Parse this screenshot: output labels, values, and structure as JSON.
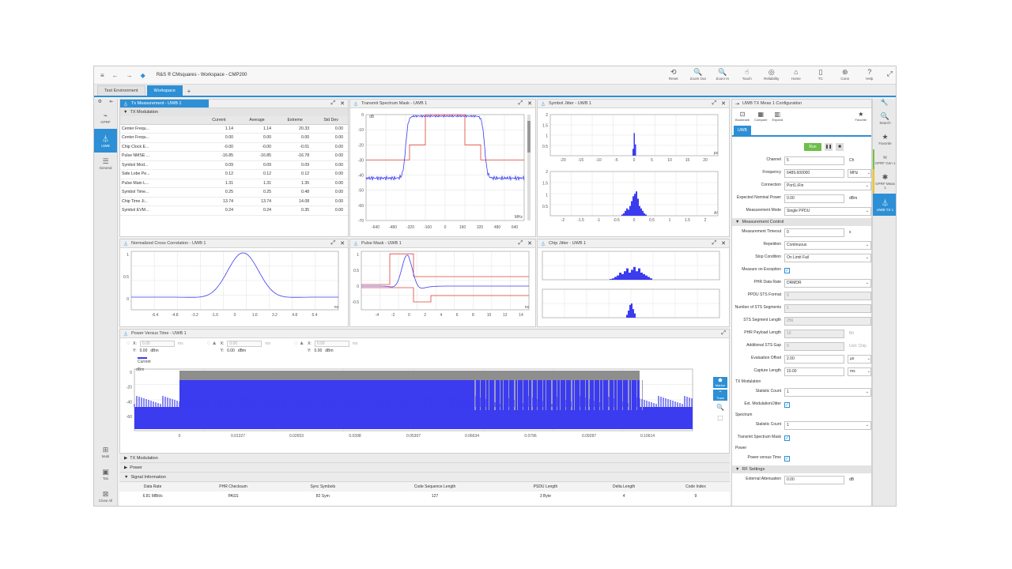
{
  "app": {
    "title": "R&S ® CMsquares - Workspace - CMP200",
    "toolbar": [
      {
        "icon": "reset-icon",
        "glyph": "⟲",
        "label": "Reset"
      },
      {
        "icon": "zoom-out-icon",
        "glyph": "🔍",
        "label": "Zoom Out"
      },
      {
        "icon": "zoom-in-icon",
        "glyph": "🔍",
        "label": "Zoom In"
      },
      {
        "icon": "touch-icon",
        "glyph": "☝",
        "label": "Touch"
      },
      {
        "icon": "reliability-icon",
        "glyph": "◎",
        "label": "Reliability"
      },
      {
        "icon": "home-icon",
        "glyph": "⌂",
        "label": "Home"
      },
      {
        "icon": "tc-icon",
        "glyph": "▯",
        "label": "TC"
      },
      {
        "icon": "conn-icon",
        "glyph": "⊛",
        "label": "Conn"
      },
      {
        "icon": "help-icon",
        "glyph": "?",
        "label": "Help"
      }
    ],
    "tabs": [
      {
        "label": "Test Environment",
        "active": false
      },
      {
        "label": "Workspace",
        "active": true
      }
    ]
  },
  "left_sidebar": [
    {
      "icon": "gprf-icon",
      "glyph": "⌁",
      "label": "GPRF",
      "active": false
    },
    {
      "icon": "uwb-icon",
      "glyph": "⏃",
      "label": "UWB",
      "active": true
    },
    {
      "icon": "general-icon",
      "glyph": "☰",
      "label": "General",
      "active": false
    }
  ],
  "left_sidebar_bottom": [
    {
      "icon": "multi-icon",
      "glyph": "⊞",
      "label": "Multi"
    },
    {
      "icon": "tas-icon",
      "glyph": "▣",
      "label": "Tas"
    },
    {
      "icon": "close-all-icon",
      "glyph": "⊠",
      "label": "Close All"
    }
  ],
  "right_sidebar": [
    {
      "icon": "search-icon",
      "glyph": "🔍",
      "label": "Search",
      "variant": ""
    },
    {
      "icon": "favorite-icon",
      "glyph": "★",
      "label": "Favorite",
      "variant": ""
    },
    {
      "icon": "gprf-gen-icon",
      "glyph": "≈",
      "label": "GPRF Gen 1",
      "variant": "green"
    },
    {
      "icon": "gprf-meas-icon",
      "glyph": "✱",
      "label": "GPRF Meas 1",
      "variant": "yellow"
    },
    {
      "icon": "uwb-tx-icon",
      "glyph": "⏃",
      "label": "UWB TX 1",
      "variant": "active"
    }
  ],
  "tx_panel": {
    "title": "Tx Measurement - UWB 1",
    "section": "TX Modulation",
    "columns": [
      "",
      "Current",
      "Average",
      "Extreme",
      "Std Dev"
    ],
    "rows": [
      [
        "Center Frequ...",
        "1.14",
        "1.14",
        "20.33",
        "0.00"
      ],
      [
        "Center Frequ...",
        "0.00",
        "0.00",
        "0.00",
        "0.00"
      ],
      [
        "Chip Clock E...",
        "-0.00",
        "-0.00",
        "-0.01",
        "0.00"
      ],
      [
        "Pulse NMSE ...",
        "-16.85",
        "-16.85",
        "-16.78",
        "0.00"
      ],
      [
        "Symbol Mod...",
        "0.09",
        "0.09",
        "0.09",
        "0.00"
      ],
      [
        "Side Lobe Pe...",
        "0.12",
        "0.12",
        "0.12",
        "0.00"
      ],
      [
        "Pulse Main L...",
        "1.31",
        "1.31",
        "1.35",
        "0.00"
      ],
      [
        "Symbol Time...",
        "0.25",
        "0.25",
        "0.48",
        "0.00"
      ],
      [
        "Chip Time Ji...",
        "13.74",
        "13.74",
        "14.08",
        "0.00"
      ],
      [
        "Symbol EVM...",
        "0.24",
        "0.24",
        "0.35",
        "0.00"
      ]
    ]
  },
  "spectrum_panel": {
    "title": "Transmit Spectrum Mask - UWB 1",
    "yunit": "dB",
    "xunit": "MHz",
    "yticks": [
      "0",
      "-10",
      "-20",
      "-30",
      "-40",
      "-50",
      "-60",
      "-70"
    ],
    "xticks": [
      "-640",
      "-480",
      "-320",
      "-160",
      "0",
      "160",
      "320",
      "480",
      "640"
    ]
  },
  "symbol_jitter_panel": {
    "title": "Symbol Jitter - UWB 1",
    "xunit": "ps",
    "xunit2": "A²",
    "top_yticks": [
      "2",
      "1.5",
      "1",
      "0.5"
    ],
    "top_xticks": [
      "-20",
      "-15",
      "-10",
      "-5",
      "0",
      "5",
      "10",
      "15",
      "20"
    ],
    "bot_yticks": [
      "2",
      "1.5",
      "1",
      "0.5"
    ],
    "bot_xticks": [
      "-2",
      "-1.5",
      "-1",
      "-0.5",
      "0",
      "0.5",
      "1",
      "1.5",
      "2"
    ]
  },
  "cross_corr_panel": {
    "title": "Normalized Cross Correlation - UWB 1",
    "xunit": "ns",
    "yticks": [
      "1",
      "0.5",
      "0"
    ],
    "xticks": [
      "-6.4",
      "-4.8",
      "-3.2",
      "-1.6",
      "0",
      "1.6",
      "3.2",
      "4.8",
      "6.4"
    ]
  },
  "pulse_mask_panel": {
    "title": "Pulse Mask - UWB 1",
    "xunit": "ns",
    "yticks": [
      "1",
      "0.5",
      "0",
      "-0.5"
    ],
    "xticks": [
      "-4",
      "-2",
      "0",
      "2",
      "4",
      "6",
      "8",
      "10",
      "12",
      "14"
    ]
  },
  "chip_jitter_panel": {
    "title": "Chip Jitter - UWB 1"
  },
  "pvt_panel": {
    "title": "Power Versus Time - UWB 1",
    "markers": [
      {
        "x_label": "X:",
        "x_value": "0.00",
        "x_unit": "ms",
        "y_label": "Y:",
        "y_value": "0.00",
        "y_unit": "dBm"
      },
      {
        "x_label": "X:",
        "x_value": "0.00",
        "x_unit": "ms",
        "y_label": "Y:",
        "y_value": "0.00",
        "y_unit": "dBm"
      },
      {
        "x_label": "X:",
        "x_value": "0.00",
        "x_unit": "ms",
        "y_label": "Y:",
        "y_value": "0.00",
        "y_unit": "dBm"
      }
    ],
    "legend": "Current",
    "yunit": "dBm",
    "yticks": [
      "0",
      "-20",
      "-40",
      "-60"
    ],
    "xticks": [
      "0",
      "0.01327",
      "0.02653",
      "0.0398",
      "0.05307",
      "0.06634",
      "0.0796",
      "0.09287",
      "0.10614"
    ],
    "side_buttons": [
      {
        "icon": "marker-icon",
        "glyph": "⬟",
        "label": "Marker"
      },
      {
        "icon": "trace-icon",
        "glyph": "⌃",
        "label": "Trace"
      }
    ]
  },
  "bottom_sections": [
    "TX Modulation",
    "Power",
    "Signal Information"
  ],
  "signal_info": {
    "columns": [
      "Data Rate",
      "PHR Checksum",
      "Sync Symbols",
      "Code Sequence Length",
      "PSDU Length",
      "Delta Length",
      "Code Index"
    ],
    "values": [
      "6.81 MBit/s",
      "PASS",
      "82 Sym",
      "127",
      "3 Byte",
      "4",
      "9"
    ]
  },
  "config_panel": {
    "title": "UWB TX Meas 1 Configuration",
    "tools": [
      {
        "icon": "bookmark-icon",
        "glyph": "⊡",
        "label": "Bookmark"
      },
      {
        "icon": "compare-icon",
        "glyph": "▦",
        "label": "Compare"
      },
      {
        "icon": "expand-icon",
        "glyph": "▥",
        "label": "Expand"
      },
      {
        "icon": "favorite-icon",
        "glyph": "★",
        "label": "Favorite"
      }
    ],
    "tab": "UWB",
    "run_label": "Run",
    "main_rows": [
      {
        "label": "Channel",
        "value": "5",
        "unit": "Ch",
        "dis": false,
        "box": false
      },
      {
        "label": "Frequency",
        "value": "6489.600000",
        "unit": "MHz",
        "dis": false,
        "box": true
      },
      {
        "label": "Connection",
        "value": "Port1.iFin",
        "unit": "",
        "dis": false,
        "box": false,
        "wide": true
      },
      {
        "label": "Expected Nominal Power",
        "value": "0.00",
        "unit": "dBm",
        "dis": false,
        "box": false
      },
      {
        "label": "Measurement Mode",
        "value": "Single PPDU",
        "unit": "",
        "dis": false,
        "box": false,
        "wide": true
      }
    ],
    "control_section": "Measurement Control",
    "control_rows": [
      {
        "label": "Measurement Timeout",
        "value": "0",
        "unit": "s",
        "dis": false,
        "box": false
      },
      {
        "label": "Repetition",
        "value": "Continuous",
        "unit": "",
        "dis": false,
        "box": false,
        "wide": true
      },
      {
        "label": "Stop Condition",
        "value": "On Limit Fail",
        "unit": "",
        "dis": false,
        "box": false,
        "wide": true
      },
      {
        "label": "Measure on Exception",
        "check": true
      },
      {
        "label": "PHR Data Rate",
        "value": "DRMDR",
        "unit": "",
        "dis": false,
        "box": false,
        "wide": true
      },
      {
        "label": "PPDU STS Format",
        "value": "0",
        "unit": "",
        "dis": true,
        "box": false,
        "wide": true
      },
      {
        "label": "Number of STS Segments",
        "value": "1",
        "unit": "",
        "dis": true,
        "box": false,
        "wide": true
      },
      {
        "label": "STS Segment Length",
        "value": "256",
        "unit": "",
        "dis": true,
        "box": false,
        "wide": true
      },
      {
        "label": "PHR Payload Length",
        "value": "10",
        "unit": "Bit",
        "dis": true,
        "box": false
      },
      {
        "label": "Additional STS Gap",
        "value": "0",
        "unit": "Unit: Chip",
        "dis": true,
        "box": false
      },
      {
        "label": "Evaluation Offset",
        "value": "2.00",
        "unit": "µs",
        "dis": false,
        "box": true
      },
      {
        "label": "Capture Length",
        "value": "10.00",
        "unit": "ms",
        "dis": false,
        "box": true
      }
    ],
    "tx_mod_label": "TX Modulation",
    "tx_mod_rows": [
      {
        "label": "Statistic Count",
        "value": "1",
        "unit": "",
        "dis": false,
        "box": false,
        "wide": true
      },
      {
        "label": "Ext. Modulation/Jitter",
        "check": true
      }
    ],
    "spectrum_label": "Spectrum",
    "spectrum_rows": [
      {
        "label": "Statistic Count",
        "value": "1",
        "unit": "",
        "dis": false,
        "box": false,
        "wide": true
      },
      {
        "label": "Transmit Spectrum Mask",
        "check": true
      }
    ],
    "power_label": "Power",
    "power_rows": [
      {
        "label": "Power versus Time",
        "check": true
      }
    ],
    "rf_section": "RF Settings",
    "rf_rows": [
      {
        "label": "External Attenuation",
        "value": "0.00",
        "unit": "dB",
        "dis": false,
        "box": false
      }
    ]
  },
  "colors": {
    "accent": "#2d8fd5",
    "trace": "#3b3bf0",
    "limit": "#e0413a",
    "run": "#6cc04a"
  }
}
